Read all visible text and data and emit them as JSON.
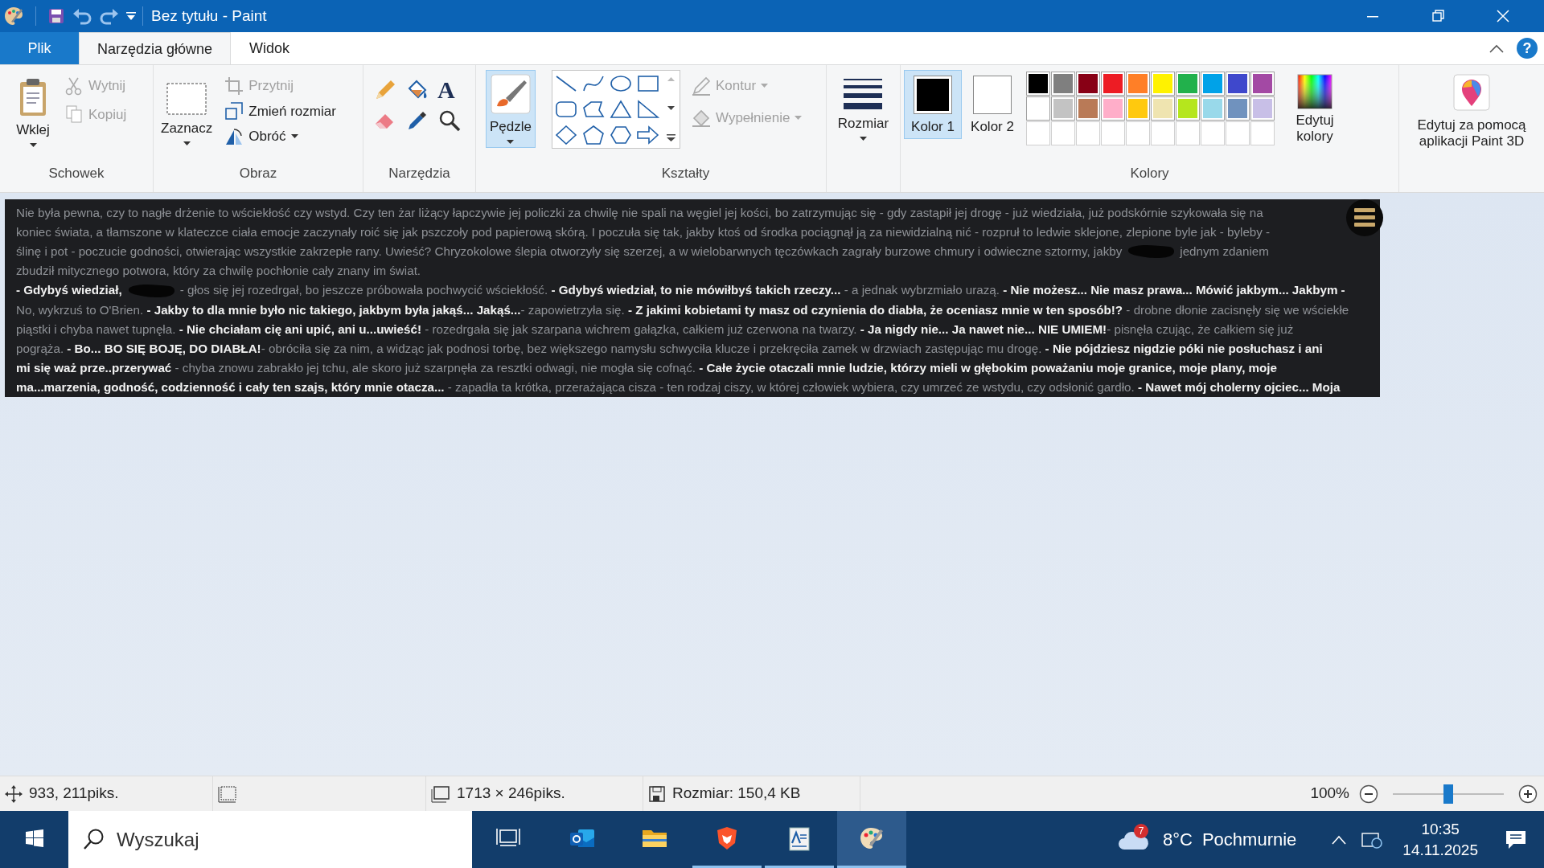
{
  "title_bar": {
    "title": "Bez tytułu - Paint"
  },
  "help_button": "?",
  "menu_tabs": [
    {
      "label": "Plik",
      "kind": "file",
      "selected": false
    },
    {
      "label": "Narzędzia główne",
      "kind": "tab",
      "selected": true
    },
    {
      "label": "Widok",
      "kind": "tab",
      "selected": false
    }
  ],
  "ribbon": {
    "clipboard": {
      "title": "Schowek",
      "paste": {
        "label": "Wklej"
      },
      "cut": {
        "label": "Wytnij",
        "disabled": true
      },
      "copy": {
        "label": "Kopiuj",
        "disabled": true
      }
    },
    "image": {
      "title": "Obraz",
      "select": {
        "label": "Zaznacz"
      },
      "crop": {
        "label": "Przytnij",
        "disabled": true
      },
      "resize": {
        "label": "Zmień rozmiar",
        "disabled": false
      },
      "rotate": {
        "label": "Obróć",
        "disabled": false
      }
    },
    "tools": {
      "title": "Narzędzia",
      "text_tool": "A"
    },
    "brushes": {
      "label": "Pędzle",
      "selected": true
    },
    "shapes": {
      "title": "Kształty",
      "outline": {
        "label": "Kontur",
        "disabled": true
      },
      "fill": {
        "label": "Wypełnienie",
        "disabled": true
      }
    },
    "size": {
      "label": "Rozmiar"
    },
    "colors": {
      "title": "Kolory",
      "color1": {
        "label": "Kolor 1",
        "selected": true,
        "color": "#000000"
      },
      "color2": {
        "label": "Kolor 2",
        "selected": false,
        "color": "#ffffff"
      },
      "palette": [
        {
          "color": "#000000"
        },
        {
          "color": "#7f7f7f"
        },
        {
          "color": "#880015"
        },
        {
          "color": "#ed1c24"
        },
        {
          "color": "#ff7f27"
        },
        {
          "color": "#fff200"
        },
        {
          "color": "#22b14c"
        },
        {
          "color": "#00a2e8"
        },
        {
          "color": "#3f48cc"
        },
        {
          "color": "#a349a4"
        },
        {
          "color": "#ffffff"
        },
        {
          "color": "#c3c3c3"
        },
        {
          "color": "#b97a57"
        },
        {
          "color": "#ffaec9"
        },
        {
          "color": "#ffc90e"
        },
        {
          "color": "#efe4b0"
        },
        {
          "color": "#b5e61d"
        },
        {
          "color": "#99d9ea"
        },
        {
          "color": "#7092be"
        },
        {
          "color": "#c8bfe7"
        }
      ],
      "edit": {
        "label": "Edytuj kolory"
      }
    },
    "paint3d": {
      "label": "Edytuj za pomocą aplikacji Paint 3D"
    }
  },
  "canvas": {
    "lines": [
      {
        "parts": [
          {
            "kind": "text",
            "text": "Nie była pewna, czy to nagłe drżenie to wściekłość czy wstyd. Czy ten żar liżący łapczywie jej policzki za chwilę nie spali na węgiel jej kości, bo zatrzymując się - gdy zastąpił jej drogę - już wiedziała, już podskórnie szykowała się na"
          }
        ]
      },
      {
        "parts": [
          {
            "kind": "text",
            "text": "koniec świata, a tłamszone w klateczce ciała emocje zaczynały roić się jak pszczoły pod papierową skórą. I poczuła się tak, jakby ktoś od środka pociągnął ją za niewidzialną nić - rozpruł to ledwie sklejone, zlepione byle jak - byleby -"
          }
        ]
      },
      {
        "parts": [
          {
            "kind": "text",
            "text": "ślinę i pot - poczucie godności, otwierając wszystkie zakrzepłe rany. Uwieść? Chryzokolowe ślepia otworzyły się szerzej, a w wielobarwnych tęczówkach zagrały burzowe chmury i odwieczne sztormy, jakby"
          },
          {
            "kind": "redaction"
          },
          {
            "kind": "text",
            "text": "jednym zdaniem"
          }
        ]
      },
      {
        "parts": [
          {
            "kind": "text",
            "text": "zbudził mitycznego potwora, który za chwilę pochłonie cały znany im świat."
          }
        ]
      },
      {
        "parts": [
          {
            "kind": "text",
            "text": "**- Gdybyś wiedział,**"
          },
          {
            "kind": "redaction"
          },
          {
            "kind": "text",
            "text": "- głos się jej rozedrgał, bo jeszcze próbowała pochwycić wściekłość. **- Gdybyś wiedział, to nie mówiłbyś takich rzeczy...** - a jednak wybrzmiało urazą. **- Nie możesz... Nie masz prawa... Mówić jakbym... Jakbym -**"
          }
        ]
      },
      {
        "parts": [
          {
            "kind": "text",
            "text": "No, wykrzuś to O'Brien. **- Jakby to dla mnie było nic takiego, jakbym była jakąś... Jakąś...**- zapowietrzyła się. **- Z jakimi kobietami ty masz od czynienia do diabła, że oceniasz mnie w ten sposób!?** - drobne dłonie zacisnęły się we wściekłe"
          }
        ]
      },
      {
        "parts": [
          {
            "kind": "text",
            "text": "piąstki i chyba nawet tupnęła. **- Nie chciałam cię ani upić, ani u...uwieść!** - rozedrgała się jak szarpana wichrem gałązka, całkiem już czerwona na twarzy. **- Ja nigdy nie... Ja nawet nie... NIE UMIEM!**- pisnęła czując, że całkiem się już"
          }
        ]
      },
      {
        "parts": [
          {
            "kind": "text",
            "text": "pogrąża. **- Bo... BO SIĘ BOJĘ, DO DIABŁA!**- obróciła się za nim, a widząc jak podnosi torbę, bez większego namysłu schwyciła klucze i przekręciła zamek w drzwiach zastępując mu drogę. **- Nie pójdziesz nigdzie póki nie posłuchasz i ani**"
          }
        ]
      },
      {
        "parts": [
          {
            "kind": "text",
            "text": "**mi się waż prze..przerywać** - chyba znowu zabrakło jej tchu, ale skoro już szarpnęła za resztki odwagi, nie mogła się cofnąć. **- Całe życie otaczali mnie ludzie, którzy mieli w głębokim poważaniu moje granice, moje plany, moje**"
          }
        ]
      },
      {
        "parts": [
          {
            "kind": "text",
            "text": "**ma...marzenia, godność, codzienność i cały ten szajs, który mnie otacza...** - zapadła ta krótka, przerażająca cisza - ten rodzaj ciszy, w której człowiek wybiera, czy umrzeć ze wstydu, czy odsłonić gardło. **- Nawet mój cholerny ojciec... Moja**"
          }
        ]
      }
    ]
  },
  "status_bar": {
    "cursor_position": "933, 211piks.",
    "image_size": "1713 × 246piks.",
    "file_size": "Rozmiar: 150,4 KB",
    "zoom": "100%",
    "zoom_slider": {
      "level": 0.5
    }
  },
  "taskbar": {
    "search_placeholder": "Wyszukaj",
    "apps": [
      {
        "kind": "taskview",
        "running": false,
        "selected": false
      },
      {
        "kind": "mail",
        "running": false,
        "selected": false
      },
      {
        "kind": "folder",
        "running": false,
        "selected": false
      },
      {
        "kind": "lion",
        "running": true,
        "selected": false
      },
      {
        "kind": "document",
        "running": true,
        "selected": false
      },
      {
        "kind": "paint",
        "running": true,
        "selected": true
      }
    ],
    "weather_badge": "7",
    "temperature": "8°C",
    "weather": "Pochmurnie",
    "time": "10:35",
    "date": "14.11.2025"
  }
}
